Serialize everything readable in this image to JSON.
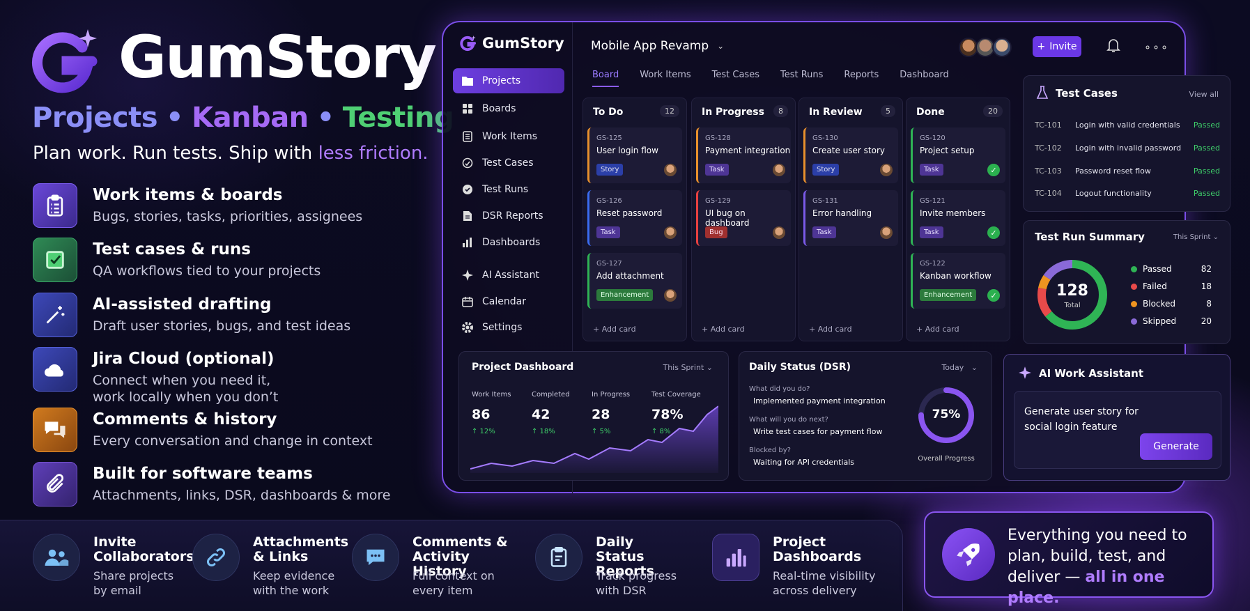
{
  "brand": {
    "name": "GumStory",
    "tagline_1": "Projects",
    "tagline_dot": "•",
    "tagline_2": "Kanban",
    "tagline_3": "Testing",
    "subtag_a": "Plan work. Run tests. Ship with",
    "subtag_b": "less friction."
  },
  "features": [
    {
      "title": "Work items & boards",
      "desc": "Bugs, stories, tasks, priorities, assignees",
      "icon": "clipboard-list-icon"
    },
    {
      "title": "Test cases & runs",
      "desc": "QA workflows tied to your projects",
      "icon": "checkbox-icon"
    },
    {
      "title": "AI-assisted drafting",
      "desc": "Draft user stories, bugs, and test ideas",
      "icon": "magic-wand-icon"
    },
    {
      "title": "Jira Cloud (optional)",
      "desc": "Connect when you need it,",
      "desc2": "work locally when you don’t",
      "icon": "cloud-icon"
    },
    {
      "title": "Comments & history",
      "desc": "Every conversation and change in context",
      "icon": "chat-bubbles-icon"
    },
    {
      "title": "Built for software teams",
      "desc": "Attachments, links, DSR, dashboards & more",
      "icon": "paperclip-icon"
    }
  ],
  "app": {
    "logo": "GumStory",
    "project": "Mobile App Revamp",
    "invite": "Invite",
    "more": "∘∘∘",
    "nav": [
      {
        "label": "Projects",
        "icon": "folder-icon"
      },
      {
        "label": "Boards",
        "icon": "grid-icon"
      },
      {
        "label": "Work Items",
        "icon": "list-icon"
      },
      {
        "label": "Test Cases",
        "icon": "flask-icon"
      },
      {
        "label": "Test Runs",
        "icon": "check-circle-icon"
      },
      {
        "label": "DSR Reports",
        "icon": "document-icon"
      },
      {
        "label": "Dashboards",
        "icon": "bar-chart-icon"
      },
      {
        "label": "AI Assistant",
        "icon": "sparkle-icon"
      },
      {
        "label": "Calendar",
        "icon": "calendar-icon"
      },
      {
        "label": "Settings",
        "icon": "gear-icon"
      }
    ],
    "tabs": [
      "Board",
      "Work Items",
      "Test Cases",
      "Test Runs",
      "Reports",
      "Dashboard"
    ],
    "columns": [
      {
        "name": "To Do",
        "count": "12",
        "cards": [
          {
            "key": "GS-125",
            "name": "User login flow",
            "tag": "Story",
            "tagType": "story",
            "color": "#e8902c"
          },
          {
            "key": "GS-126",
            "name": "Reset password",
            "tag": "Task",
            "tagType": "task",
            "color": "#3a6cf0"
          },
          {
            "key": "GS-127",
            "name": "Add attachment",
            "tag": "Enhancement",
            "tagType": "enh",
            "color": "#2fb455"
          }
        ]
      },
      {
        "name": "In Progress",
        "count": "8",
        "cards": [
          {
            "key": "GS-128",
            "name": "Payment integration",
            "tag": "Task",
            "tagType": "task",
            "color": "#e8902c"
          },
          {
            "key": "GS-129",
            "name": "UI bug on dashboard",
            "tag": "Bug",
            "tagType": "bug",
            "color": "#e84040"
          }
        ]
      },
      {
        "name": "In Review",
        "count": "5",
        "cards": [
          {
            "key": "GS-130",
            "name": "Create user story",
            "tag": "Story",
            "tagType": "story",
            "color": "#e8902c"
          },
          {
            "key": "GS-131",
            "name": "Error handling",
            "tag": "Task",
            "tagType": "task",
            "color": "#7a5ae8"
          }
        ]
      },
      {
        "name": "Done",
        "count": "20",
        "cards": [
          {
            "key": "GS-120",
            "name": "Project setup",
            "tag": "Task",
            "tagType": "task",
            "color": "#2fb455"
          },
          {
            "key": "GS-121",
            "name": "Invite members",
            "tag": "Task",
            "tagType": "task",
            "color": "#2fb455"
          },
          {
            "key": "GS-122",
            "name": "Kanban workflow",
            "tag": "Enhancement",
            "tagType": "enh",
            "color": "#2fb455"
          }
        ]
      }
    ],
    "add_card": "+ Add card",
    "test_cases": {
      "title": "Test Cases",
      "view_all": "View all",
      "rows": [
        {
          "id": "TC-101",
          "name": "Login with valid credentials",
          "status": "Passed"
        },
        {
          "id": "TC-102",
          "name": "Login with invalid password",
          "status": "Passed"
        },
        {
          "id": "TC-103",
          "name": "Password reset flow",
          "status": "Passed"
        },
        {
          "id": "TC-104",
          "name": "Logout functionality",
          "status": "Passed"
        }
      ]
    },
    "test_run_summary": {
      "title": "Test Run Summary",
      "filter": "This Sprint",
      "total": "128",
      "total_label": "Total",
      "items": [
        {
          "label": "Passed",
          "value": 82,
          "color": "#2fb455"
        },
        {
          "label": "Failed",
          "value": 18,
          "color": "#e84a4a"
        },
        {
          "label": "Blocked",
          "value": 8,
          "color": "#ef9420"
        },
        {
          "label": "Skipped",
          "value": 20,
          "color": "#8a6ad8"
        }
      ]
    },
    "project_dashboard": {
      "title": "Project Dashboard",
      "filter": "This Sprint",
      "stats": [
        {
          "label": "Work Items",
          "value": "86",
          "change": "↑ 12%"
        },
        {
          "label": "Completed",
          "value": "42",
          "change": "↑ 18%"
        },
        {
          "label": "In Progress",
          "value": "28",
          "change": "↑ 5%"
        },
        {
          "label": "Test Coverage",
          "value": "78%",
          "change": "↑ 8%"
        }
      ]
    },
    "dsr": {
      "title": "Daily Status (DSR)",
      "filter": "Today",
      "q1": "What did you do?",
      "a1": "Implemented payment integration",
      "q2": "What will you do next?",
      "a2": "Write test cases for payment flow",
      "q3": "Blocked by?",
      "a3": "Waiting for API credentials",
      "progress_value": 75,
      "progress": "75%",
      "progress_label": "Overall Progress"
    },
    "ai": {
      "title": "AI Work Assistant",
      "prompt": "Generate user story for social login feature",
      "button": "Generate"
    }
  },
  "bottom": [
    {
      "title": "Invite Collaborators",
      "desc": "Share projects by email",
      "icon": "users-icon"
    },
    {
      "title": "Attachments & Links",
      "desc": "Keep evidence with the work",
      "icon": "link-icon"
    },
    {
      "title": "Comments & Activity History",
      "desc": "Full context on every item",
      "icon": "comment-icon"
    },
    {
      "title": "Daily Status Reports",
      "desc": "Track progress with DSR",
      "icon": "report-icon"
    },
    {
      "title": "Project Dashboards",
      "desc": "Real-time visibility across delivery",
      "icon": "bar-chart-icon"
    }
  ],
  "cta": {
    "text": "Everything you need to plan, build, test, and deliver —",
    "highlight": "all in one place."
  }
}
